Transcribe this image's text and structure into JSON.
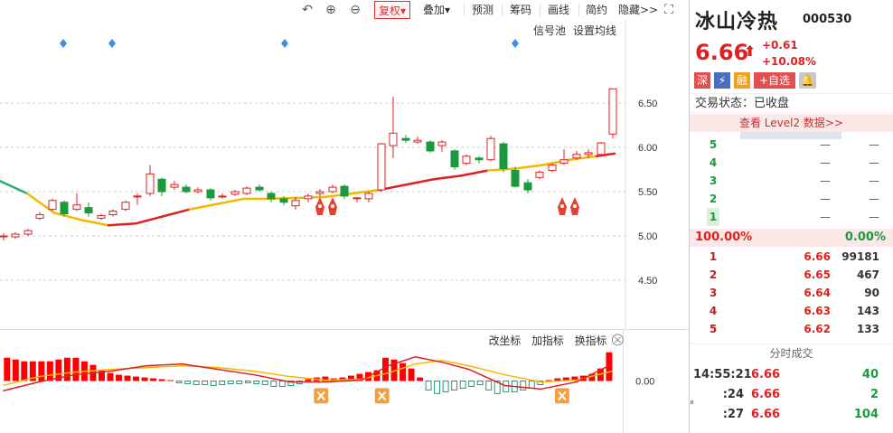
{
  "toolbar": {
    "undo_icon": "undo-icon",
    "zoom_in_icon": "zoom-in-icon",
    "zoom_out_icon": "zoom-out-icon",
    "fuquan": "复权▾",
    "diejia": "叠加▾",
    "yuce": "预测",
    "chouma": "筹码",
    "huaxian": "画线",
    "jianyue": "简约",
    "yincang": "隐藏>>",
    "fullscreen_icon": "fullscreen-icon"
  },
  "main_chart": {
    "links": [
      "信号池",
      "设置均线"
    ],
    "y_ticks": [
      "6.50",
      "6.00",
      "5.50",
      "5.00",
      "4.50"
    ],
    "colors": {
      "up": "#e02020",
      "down": "#1a9a3a",
      "ma_yellow": "#f5b800",
      "ma_red": "#e02020",
      "ma_green": "#20b070",
      "diamond": "#3a8ee6"
    }
  },
  "sub_chart": {
    "links": [
      "改坐标",
      "加指标",
      "换指标"
    ],
    "close_icon": "close-icon",
    "y_tick": "0.00"
  },
  "quote": {
    "name": "冰山冷热",
    "code": "000530",
    "price": "6.66",
    "arrow": "⬆",
    "change": "+0.61",
    "change_pct": "+10.08%",
    "badges": [
      "深",
      "⚡",
      "融",
      "+自选"
    ],
    "status": "交易状态：已收盘",
    "level2": "查看 Level2 数据>>"
  },
  "order_book": {
    "asks": [
      {
        "level": "5",
        "price": "—",
        "vol": "—"
      },
      {
        "level": "4",
        "price": "—",
        "vol": "—"
      },
      {
        "level": "3",
        "price": "—",
        "vol": "—"
      },
      {
        "level": "2",
        "price": "—",
        "vol": "—"
      },
      {
        "level": "1",
        "price": "—",
        "vol": "—"
      }
    ],
    "ratio_left": "100.00%",
    "ratio_right": "0.00%",
    "bids": [
      {
        "level": "1",
        "price": "6.66",
        "vol": "99181"
      },
      {
        "level": "2",
        "price": "6.65",
        "vol": "467"
      },
      {
        "level": "3",
        "price": "6.64",
        "vol": "90"
      },
      {
        "level": "4",
        "price": "6.63",
        "vol": "143"
      },
      {
        "level": "5",
        "price": "6.62",
        "vol": "133"
      }
    ]
  },
  "trades": {
    "title": "分时成交",
    "rows": [
      {
        "time": "14:55:21",
        "price": "6.66",
        "vol": "40",
        "color": "#1a9a3a"
      },
      {
        "time": ":24",
        "price": "6.66",
        "vol": "2",
        "color": "#1a9a3a"
      },
      {
        "time": ":27",
        "price": "6.66",
        "vol": "104",
        "color": "#1a9a3a"
      }
    ]
  }
}
